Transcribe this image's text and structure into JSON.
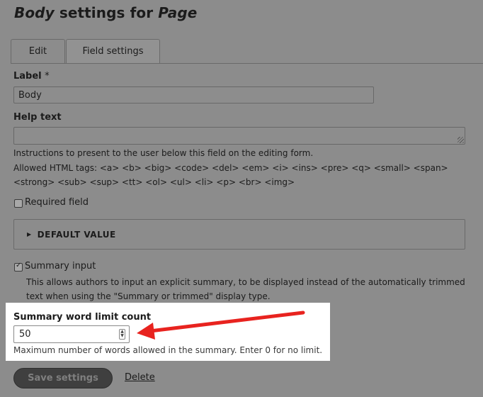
{
  "title": {
    "field": "Body",
    "middle": " settings for ",
    "bundle": "Page"
  },
  "tabs": [
    {
      "label": "Edit",
      "active": true
    },
    {
      "label": "Field settings",
      "active": false
    }
  ],
  "label_field": {
    "label": "Label",
    "required_mark": "*",
    "value": "Body"
  },
  "help_text": {
    "label": "Help text",
    "value": ""
  },
  "help_desc": {
    "line1": "Instructions to present to the user below this field on the editing form.",
    "line2": "Allowed HTML tags: <a> <b> <big> <code> <del> <em> <i> <ins> <pre> <q> <small> <span>",
    "line3": "<strong> <sub> <sup> <tt> <ol> <ul> <li> <p> <br> <img>"
  },
  "required": {
    "label": "Required field",
    "checked": false
  },
  "default_value": {
    "label": "DEFAULT VALUE",
    "expanded": false
  },
  "summary_input": {
    "label": "Summary input",
    "checked": true,
    "desc_line1": "This allows authors to input an explicit summary, to be displayed instead of the automatically trimmed",
    "desc_line2": "text when using the \"Summary or trimmed\" display type."
  },
  "word_limit": {
    "label": "Summary word limit count",
    "value": "50",
    "desc": "Maximum number of words allowed in the summary. Enter 0 for no limit."
  },
  "actions": {
    "save": "Save settings",
    "delete": "Delete"
  },
  "colors": {
    "overlay": "#8c8c8c",
    "highlight": "#ffffff",
    "arrow": "#e8231f"
  }
}
